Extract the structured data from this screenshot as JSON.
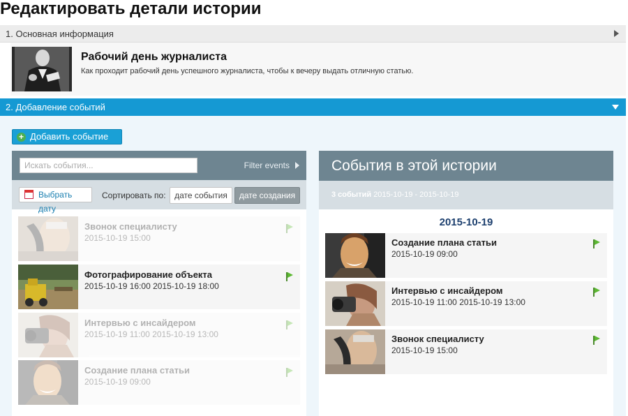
{
  "page": {
    "title": "Редактировать детали истории"
  },
  "section1": {
    "label": "1. Основная информация",
    "story_title": "Рабочий день журналиста",
    "story_description": "Как проходит рабочий день успешного журналиста, чтобы к вечеру выдать отличную статью."
  },
  "section2": {
    "label": "2. Добавление событий",
    "add_button": "Добавить событие"
  },
  "pool": {
    "search_placeholder": "Искать события...",
    "filter_label": "Filter events",
    "date_button": "Выбрать дату",
    "sort_label": "Сортировать по:",
    "sort_options": [
      "дате события",
      "дате создания"
    ],
    "sort_selected": "дате создания",
    "items": [
      {
        "title": "Звонок специалисту",
        "date": "2015-10-19 15:00",
        "added": true
      },
      {
        "title": "Фотографирование объекта",
        "date": "2015-10-19 16:00 2015-10-19 18:00",
        "added": false
      },
      {
        "title": "Интервью с инсайдером",
        "date": "2015-10-19 11:00 2015-10-19 13:00",
        "added": true
      },
      {
        "title": "Создание плана статьи",
        "date": "2015-10-19 09:00",
        "added": true
      }
    ]
  },
  "story_events": {
    "header": "События в этой истории",
    "count_label": "3 событий",
    "range": "2015-10-19 - 2015-10-19",
    "day": "2015-10-19",
    "items": [
      {
        "title": "Создание плана статьи",
        "date": "2015-10-19 09:00"
      },
      {
        "title": "Интервью с инсайдером",
        "date": "2015-10-19 11:00 2015-10-19 13:00"
      },
      {
        "title": "Звонок специалисту",
        "date": "2015-10-19 15:00"
      }
    ]
  },
  "colors": {
    "accent_blue": "#1599d3",
    "panel_header": "#6e8591",
    "panel_subheader": "#d6dee3",
    "day_heading": "#1c3f6e",
    "flag_green": "#5cb832"
  }
}
